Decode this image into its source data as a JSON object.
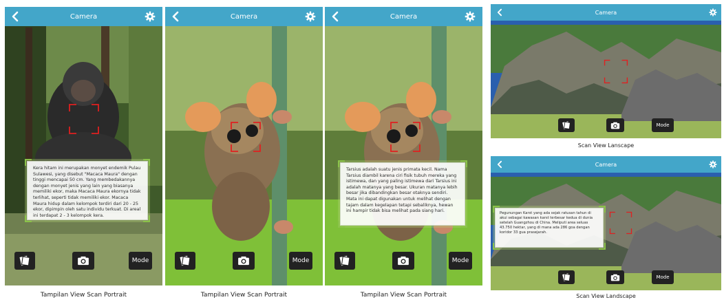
{
  "screens": [
    {
      "title": "Camera",
      "info": "Kera hitam ini merupakan monyet endemik Pulau Sulawesi, yang disebut \"Macaca Maura\" dengan tinggi mencapai 50 cm. Yang membedakannya dengan monyet jenis yang lain yang biasanya memiliki ekor, maka Macaca Maura ekornya tidak terlihat, seperti tidak memiliki ekor. Macaca Maura hidup dalam kelompok terdiri dari 20 - 25 ekor, dipimpin oleh satu individu terkuat. Di areal ini terdapat 2 - 3 kelompok kera.",
      "mode_label": "Mode",
      "caption": "Tampilan View Scan Portrait"
    },
    {
      "title": "Camera",
      "mode_label": "Mode",
      "caption": "Tampilan View Scan Portrait"
    },
    {
      "title": "Camera",
      "info": "Tarsius adalah suatu jenis primata kecil. Nama Tarsius diambil karena ciri fisik tubuh mereka yang istimewa, dan yang paling istimewa dari Tarsius ini adalah matanya yang besar. Ukuran matanya lebih besar jika dibandingkan besar otaknya sendiri. Mata ini dapat digunakan untuk melihat dengan tajam dalam kegelapan tetapi sebaliknya, hewan ini hampir tidak bisa melihat pada siang hari.",
      "mode_label": "Mode",
      "caption": "Tampilan View Scan Portrait"
    },
    {
      "title": "Camera",
      "mode_label": "Mode",
      "caption": "Scan View Lanscape"
    },
    {
      "title": "Camera",
      "info": "Pegunungan Karst yang ada sejak ratusan tahun di akui sebagai kawasan karst terbesar kedua di dunia setelah Guangzhou di China. Meliputi area seluas 43.750 hektar, yang di mana ada 286 goa dengan koridor 33 gua prasejarah.",
      "mode_label": "Mode",
      "caption": "Scan View Landscape"
    }
  ],
  "icons": {
    "back": "chevron-left-icon",
    "settings": "gear-icon",
    "gallery": "gallery-icon",
    "camera": "camera-icon"
  },
  "colors": {
    "appbar": "#43a6c9",
    "focus_brackets": "#e02020",
    "infobox_border": "#8bc34a",
    "toolbar_button": "#222222"
  }
}
